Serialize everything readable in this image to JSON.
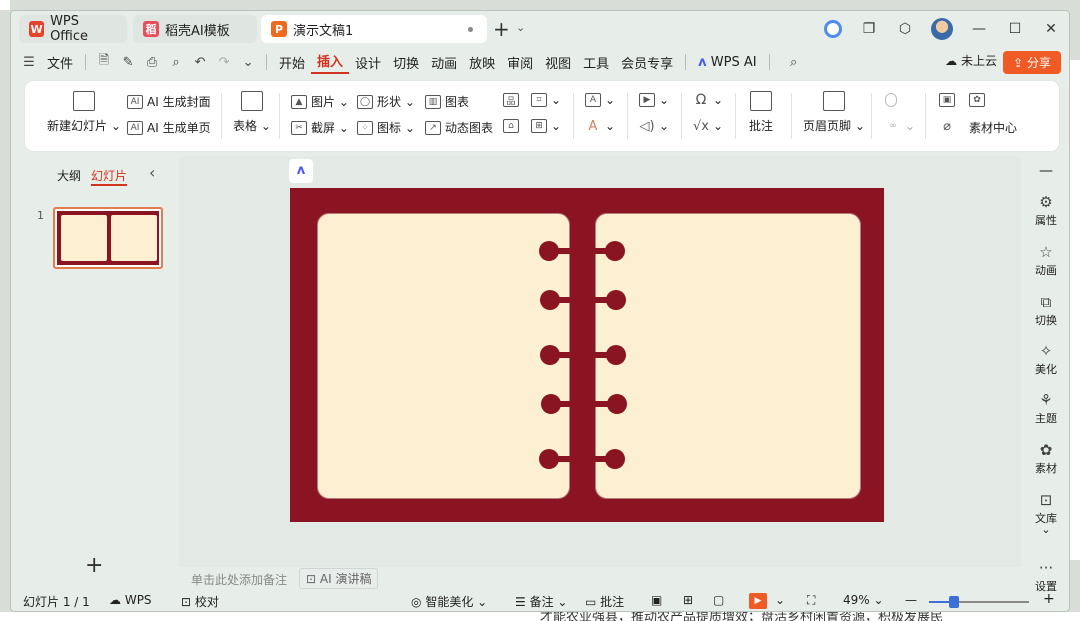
{
  "background": {
    "bottom_text": "才能农业强县，推动农产品提质增效；盘活乡村闲置资源，积极发展民"
  },
  "tabs": [
    {
      "label": "WPS Office",
      "icon": "W",
      "icon_color": "#e8412c",
      "active": false
    },
    {
      "label": "稻壳AI模板",
      "icon": "稻",
      "icon_color": "#e94d5b",
      "active": false
    },
    {
      "label": "演示文稿1",
      "icon": "P",
      "icon_color": "#f06a1c",
      "active": true
    }
  ],
  "menu": {
    "file_label": "文件",
    "items": [
      "开始",
      "插入",
      "设计",
      "切换",
      "动画",
      "放映",
      "审阅",
      "视图",
      "工具",
      "会员专享"
    ],
    "active_item": "插入",
    "wps_ai": "WPS AI",
    "cloud": "未上云",
    "share": "分享"
  },
  "ribbon": {
    "new_slide": "新建幻灯片",
    "ai_cover": "AI 生成封面",
    "ai_single": "AI 生成单页",
    "table": "表格",
    "picture": "图片",
    "screenshot": "截屏",
    "shape": "形状",
    "icon": "图标",
    "chart": "图表",
    "dynamic_chart": "动态图表",
    "comment": "批注",
    "header_footer": "页眉页脚",
    "material_center": "素材中心"
  },
  "left_panel": {
    "outline_tab": "大纲",
    "slides_tab": "幻灯片",
    "slide_number": "1"
  },
  "notes": {
    "placeholder": "单击此处添加备注",
    "ai_script": "AI 演讲稿"
  },
  "colors": {
    "slide_background": "#8a1421",
    "page": "#fdefd2",
    "accent": "#d0341e",
    "share": "#f05a24"
  },
  "right_sidebar": [
    "属性",
    "动画",
    "切换",
    "美化",
    "主题",
    "素材",
    "文库",
    "设置"
  ],
  "status": {
    "slide_count": "幻灯片 1 / 1",
    "wps": "WPS",
    "proofread": "校对",
    "beautify": "智能美化",
    "notes": "备注",
    "comment": "批注",
    "zoom": "49%",
    "zoom_fraction": 0.49
  }
}
